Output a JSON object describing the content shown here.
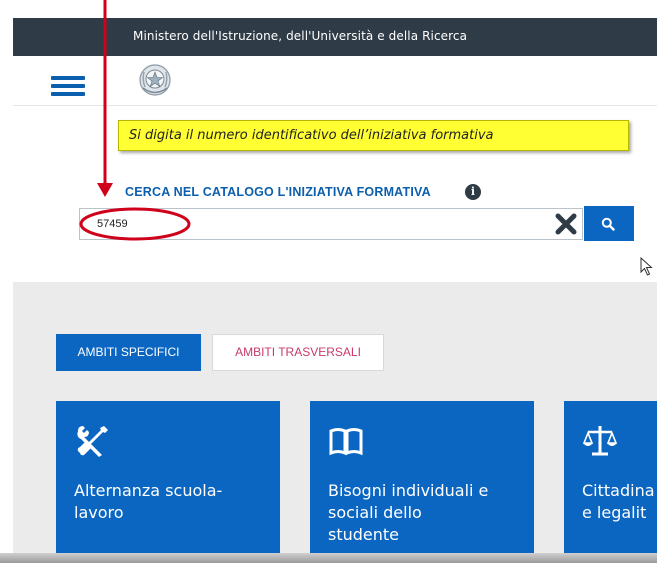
{
  "header": {
    "ministry": "Ministero dell'Istruzione, dell'Università e della Ricerca"
  },
  "navbar": {
    "menu_icon": "hamburger-menu-icon",
    "emblem_icon": "italian-republic-emblem-icon"
  },
  "annotation": {
    "callout_text": "Si digita il numero identificativo dell’iniziativa formativa",
    "arrow_color": "#d0021b",
    "highlight_color": "#ffff33"
  },
  "search": {
    "label": "CERCA NEL CATALOGO L'INIZIATIVA FORMATIVA",
    "info_icon": "info-circle-icon",
    "value": "57459",
    "clear_icon": "close-x-icon",
    "submit_icon": "search-magnifier-icon"
  },
  "tabs": [
    {
      "label": "AMBITI SPECIFICI",
      "active": true
    },
    {
      "label": "AMBITI TRASVERSALI",
      "active": false
    }
  ],
  "cards": [
    {
      "title": "Alternanza scuola-\nlavoro",
      "icon": "tools-wrench-screwdriver-icon"
    },
    {
      "title": "Bisogni individuali e\nsociali dello\nstudente",
      "icon": "open-book-icon"
    },
    {
      "title": "Cittadina\ne legalit",
      "icon": "scales-of-justice-icon"
    }
  ],
  "colors": {
    "topbar": "#2f3b46",
    "primary": "#0b66c2",
    "label_blue": "#0b5fad",
    "inactive_tab_text": "#c73a6b",
    "grey_bg": "#ebebeb"
  }
}
